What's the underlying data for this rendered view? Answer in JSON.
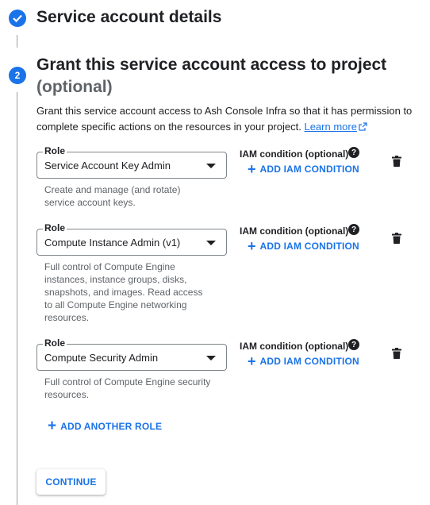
{
  "step1": {
    "title": "Service account details",
    "status_icon": "check-icon"
  },
  "step2": {
    "number": "2",
    "title": "Grant this service account access to project",
    "optional": "(optional)",
    "description": "Grant this service account access to Ash Console Infra so that it has permission to complete specific actions on the resources in your project.",
    "learn_more": "Learn more"
  },
  "roles": [
    {
      "label": "Role",
      "value": "Service Account Key Admin",
      "description": "Create and manage (and rotate) service account keys.",
      "iam_label": "IAM condition (optional)",
      "add_iam": "ADD IAM CONDITION"
    },
    {
      "label": "Role",
      "value": "Compute Instance Admin (v1)",
      "description": "Full control of Compute Engine instances, instance groups, disks, snapshots, and images. Read access to all Compute Engine networking resources.",
      "iam_label": "IAM condition (optional)",
      "add_iam": "ADD IAM CONDITION"
    },
    {
      "label": "Role",
      "value": "Compute Security Admin",
      "description": "Full control of Compute Engine security resources.",
      "iam_label": "IAM condition (optional)",
      "add_iam": "ADD IAM CONDITION"
    }
  ],
  "help_glyph": "?",
  "add_another_role": "ADD ANOTHER ROLE",
  "continue": "CONTINUE",
  "colors": {
    "accent": "#1a73e8",
    "text": "#202124",
    "muted": "#5f6368",
    "line": "#9aa0a6"
  }
}
